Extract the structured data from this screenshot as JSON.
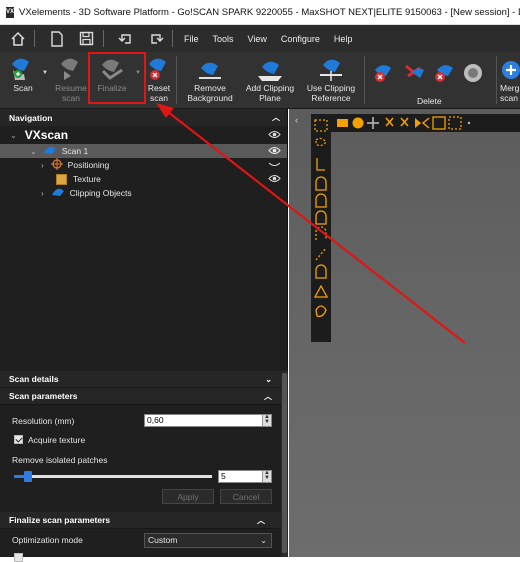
{
  "window": {
    "title": "VXelements - 3D Software Platform - Go!SCAN SPARK 9220055 - MaxSHOT NEXT|ELITE 9150063 - [New session] - DEMO LICENSE: NOT FO",
    "logo_text": "VX"
  },
  "menubar": {
    "items": [
      "File",
      "Tools",
      "View",
      "Configure",
      "Help"
    ]
  },
  "ribbon": {
    "scan": "Scan",
    "resume_scan": [
      "Resume",
      "scan"
    ],
    "finalize": "Finalize",
    "reset_scan": [
      "Reset",
      "scan"
    ],
    "remove_background": [
      "Remove",
      "Background"
    ],
    "add_clipping_plane": [
      "Add Clipping",
      "Plane"
    ],
    "use_clipping_reference": [
      "Use Clipping",
      "Reference"
    ],
    "delete_group": "Delete",
    "merge_scans": [
      "Merg",
      "scan"
    ]
  },
  "navigation": {
    "title": "Navigation",
    "root": "VXscan",
    "items": [
      {
        "label": "Scan 1"
      },
      {
        "label": "Positioning"
      },
      {
        "label": "Texture"
      },
      {
        "label": "Clipping Objects"
      }
    ]
  },
  "scan_details": {
    "title": "Scan details"
  },
  "scan_parameters": {
    "title": "Scan parameters",
    "resolution_label": "Resolution (mm)",
    "resolution_value": "0,60",
    "acquire_texture_label": "Acquire texture",
    "acquire_texture_checked": true,
    "remove_patches_label": "Remove isolated patches",
    "remove_patches_value": "5",
    "apply_label": "Apply",
    "cancel_label": "Cancel"
  },
  "finalize_parameters": {
    "title": "Finalize scan parameters",
    "optimization_mode_label": "Optimization mode",
    "optimization_mode_value": "Custom"
  },
  "colors": {
    "annotation_red": "#e01515",
    "viewport_gray": "#666666",
    "tool_orange": "#f4a100",
    "ribbon_blue": "#1f7ad8"
  }
}
